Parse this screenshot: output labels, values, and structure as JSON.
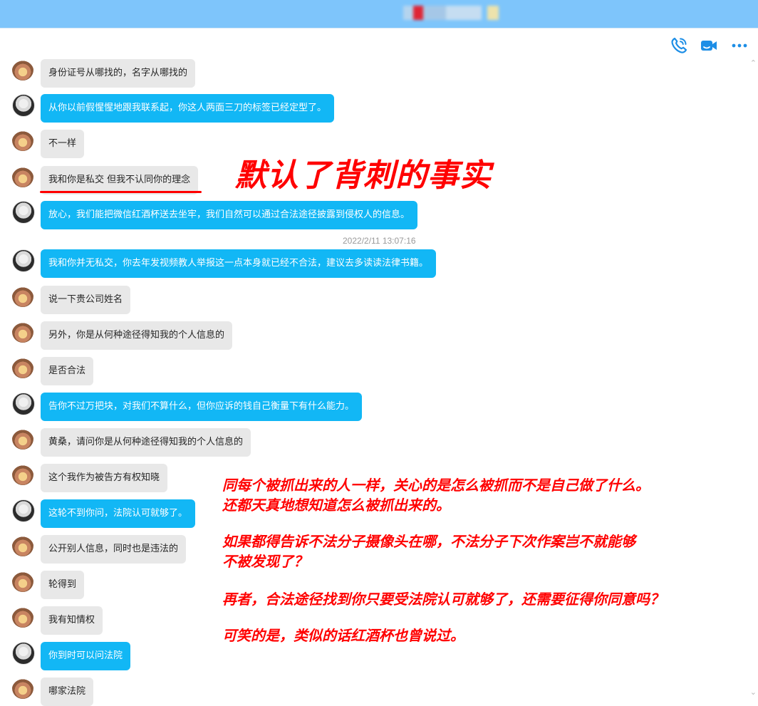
{
  "window": {
    "title_obscured": "▇▇▇▇▇▇"
  },
  "toolbar": {
    "icons": [
      "phone-call-icon",
      "video-call-icon",
      "more-icon"
    ],
    "accent_color": "#1d8ee6"
  },
  "chat": {
    "timestamp": "2022/2/11 13:07:16",
    "messages": [
      {
        "sender": "peer",
        "text": "身份证号从哪找的，名字从哪找的"
      },
      {
        "sender": "me",
        "text": "从你以前假惺惺地跟我联系起，你这人两面三刀的标签已经定型了。"
      },
      {
        "sender": "peer",
        "text": "不一样"
      },
      {
        "sender": "peer",
        "text": "我和你是私交 但我不认同你的理念"
      },
      {
        "sender": "me",
        "text": "放心，我们能把微信红酒杯送去坐牢，我们自然可以通过合法途径披露到侵权人的信息。"
      },
      {
        "sender": "me",
        "text": "我和你并无私交，你去年发视频教人举报这一点本身就已经不合法，建议去多读读法律书籍。"
      },
      {
        "sender": "peer",
        "text": "说一下贵公司姓名"
      },
      {
        "sender": "peer",
        "text": "另外，你是从何种途径得知我的个人信息的"
      },
      {
        "sender": "peer",
        "text": "是否合法"
      },
      {
        "sender": "me",
        "text": "告你不过万把块，对我们不算什么，但你应诉的钱自己衡量下有什么能力。"
      },
      {
        "sender": "peer",
        "text": "黄桑，请问你是从何种途径得知我的个人信息的"
      },
      {
        "sender": "peer",
        "text": "这个我作为被告方有权知晓"
      },
      {
        "sender": "me",
        "text": "这轮不到你问，法院认可就够了。"
      },
      {
        "sender": "peer",
        "text": "公开别人信息，同时也是违法的"
      },
      {
        "sender": "peer",
        "text": "轮得到"
      },
      {
        "sender": "peer",
        "text": "我有知情权"
      },
      {
        "sender": "me",
        "text": "你到时可以问法院"
      },
      {
        "sender": "peer",
        "text": "哪家法院"
      }
    ]
  },
  "annotations": {
    "headline": "默认了背刺的事实",
    "color": "#ff0000",
    "comments": [
      "同每个被抓出来的人一样，关心的是怎么被抓而不是自己做了什么。",
      "还都天真地想知道怎么被抓出来的。",
      "如果都得告诉不法分子摄像头在哪，不法分子下次作案岂不就能够",
      "不被发现了？",
      "再者，合法途径找到你只要受法院认可就够了，还需要征得你同意吗？",
      "可笑的是，类似的话红酒杯也曾说过。"
    ]
  }
}
